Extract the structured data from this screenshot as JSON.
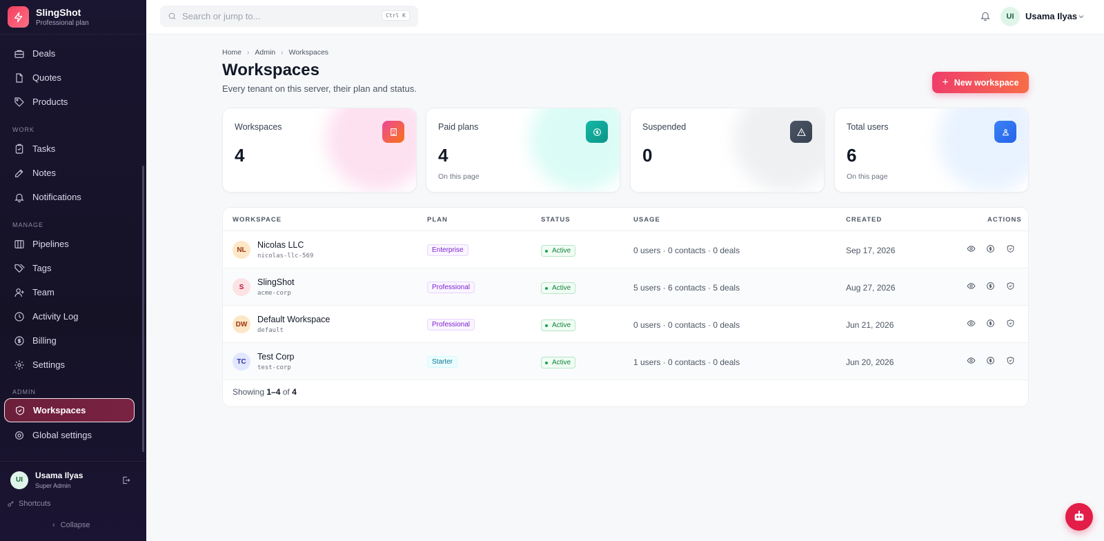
{
  "app": {
    "name": "SlingShot",
    "plan": "Professional plan"
  },
  "sidebar": {
    "top_items": [
      {
        "label": "Deals",
        "icon": "briefcase-icon"
      },
      {
        "label": "Quotes",
        "icon": "document-icon"
      },
      {
        "label": "Products",
        "icon": "tag-icon"
      }
    ],
    "sections": [
      {
        "title": "WORK",
        "items": [
          {
            "label": "Tasks",
            "icon": "checklist-icon"
          },
          {
            "label": "Notes",
            "icon": "edit-icon"
          },
          {
            "label": "Notifications",
            "icon": "bell-icon"
          }
        ]
      },
      {
        "title": "MANAGE",
        "items": [
          {
            "label": "Pipelines",
            "icon": "columns-icon"
          },
          {
            "label": "Tags",
            "icon": "tags-icon"
          },
          {
            "label": "Team",
            "icon": "user-plus-icon"
          },
          {
            "label": "Activity Log",
            "icon": "clock-icon"
          },
          {
            "label": "Billing",
            "icon": "dollar-circle-icon"
          },
          {
            "label": "Settings",
            "icon": "gear-icon"
          }
        ]
      },
      {
        "title": "ADMIN",
        "items": [
          {
            "label": "Workspaces",
            "icon": "shield-icon",
            "active": true
          },
          {
            "label": "Global settings",
            "icon": "gear-icon"
          }
        ]
      }
    ],
    "user": {
      "initials": "UI",
      "name": "Usama Ilyas",
      "role": "Super Admin"
    },
    "shortcuts_label": "Shortcuts",
    "collapse_label": "Collapse"
  },
  "topbar": {
    "search_placeholder": "Search or jump to...",
    "search_shortcut": "Ctrl K",
    "user_initials": "UI",
    "user_name": "Usama Ilyas"
  },
  "breadcrumb": [
    "Home",
    "Admin",
    "Workspaces"
  ],
  "page": {
    "title": "Workspaces",
    "subtitle": "Every tenant on this server, their plan and status.",
    "new_button": "New workspace"
  },
  "stats": [
    {
      "label": "Workspaces",
      "value": "4",
      "foot": "",
      "icon": "building-icon",
      "color": "#f43f5e"
    },
    {
      "label": "Paid plans",
      "value": "4",
      "foot": "On this page",
      "icon": "dollar-icon",
      "color": "#14b8a6"
    },
    {
      "label": "Suspended",
      "value": "0",
      "foot": "",
      "icon": "warning-icon",
      "color": "#4b5563"
    },
    {
      "label": "Total users",
      "value": "6",
      "foot": "On this page",
      "icon": "users-icon",
      "color": "#3b82f6"
    }
  ],
  "table": {
    "columns": [
      "WORKSPACE",
      "PLAN",
      "STATUS",
      "USAGE",
      "CREATED",
      "ACTIONS"
    ],
    "rows": [
      {
        "initials": "NL",
        "name": "Nicolas LLC",
        "slug": "nicolas-llc-569",
        "plan": "Enterprise",
        "status": "Active",
        "usage": "0 users · 0 contacts · 0 deals",
        "created": "Sep 17, 2026"
      },
      {
        "initials": "S",
        "name": "SlingShot",
        "slug": "acme-corp",
        "plan": "Professional",
        "status": "Active",
        "usage": "5 users · 6 contacts · 5 deals",
        "created": "Aug 27, 2026"
      },
      {
        "initials": "DW",
        "name": "Default Workspace",
        "slug": "default",
        "plan": "Professional",
        "status": "Active",
        "usage": "0 users · 0 contacts · 0 deals",
        "created": "Jun 21, 2026"
      },
      {
        "initials": "TC",
        "name": "Test Corp",
        "slug": "test-corp",
        "plan": "Starter",
        "status": "Active",
        "usage": "1 users · 0 contacts · 0 deals",
        "created": "Jun 20, 2026"
      }
    ],
    "footer": {
      "prefix": "Showing",
      "range": "1–4",
      "of": "of",
      "total": "4"
    }
  }
}
